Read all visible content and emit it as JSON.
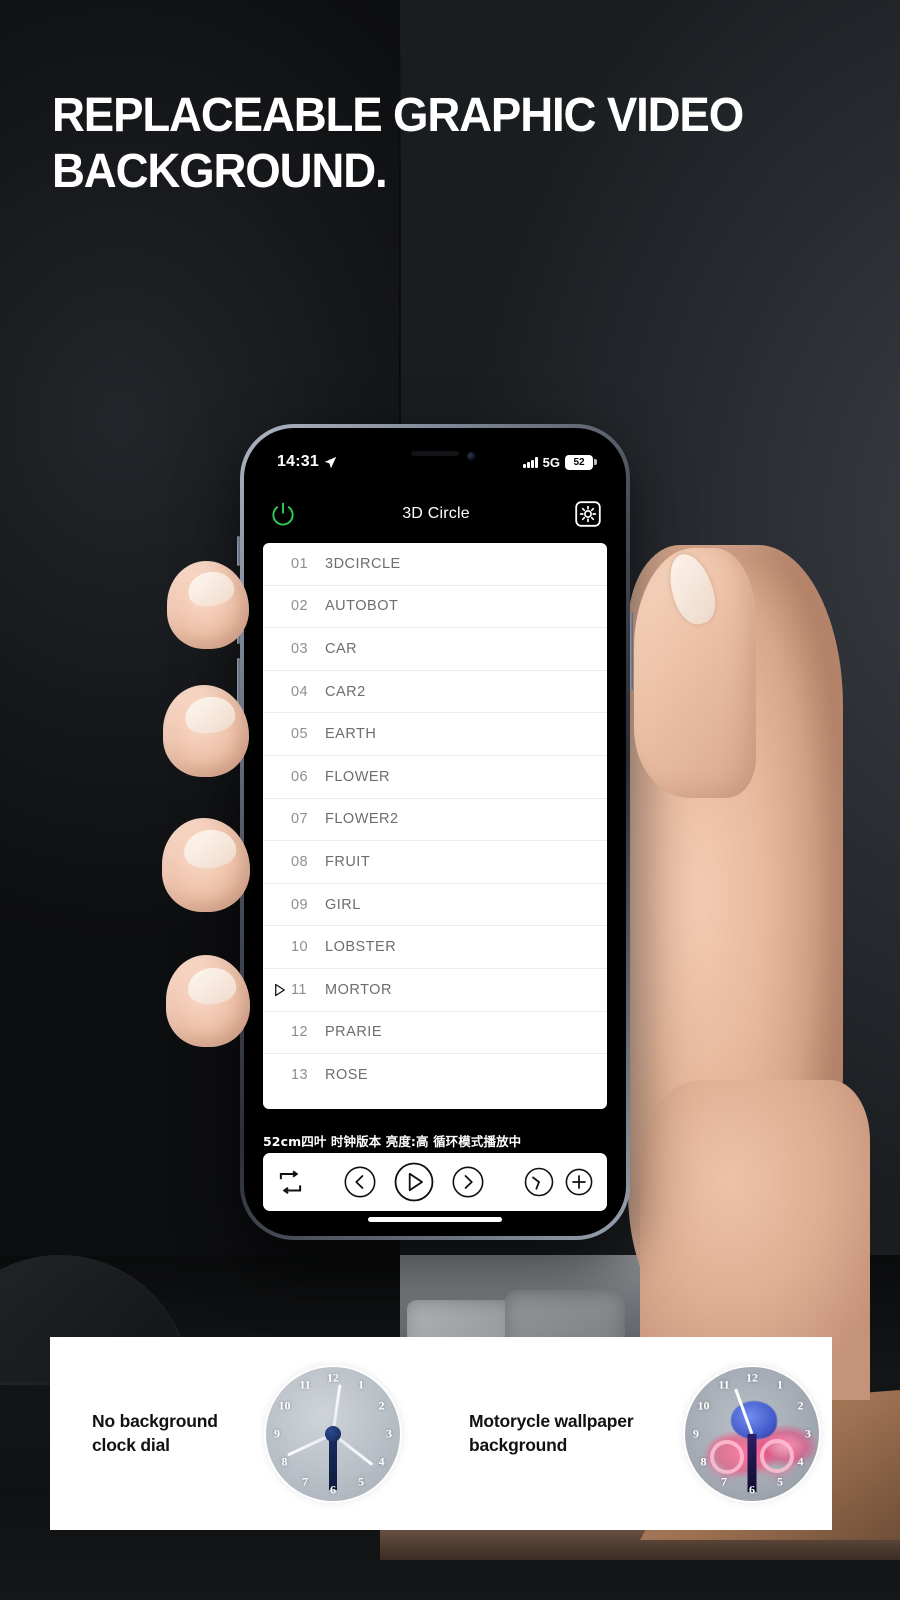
{
  "headline": {
    "line1": "REPLACEABLE GRAPHIC VIDEO",
    "line2": "BACKGROUND."
  },
  "phone": {
    "status_bar": {
      "time": "14:31",
      "location_icon": "location-arrow-icon",
      "signal_icon": "signal-bars-icon",
      "network": "5G",
      "battery_level": "52"
    },
    "app_header": {
      "power_icon": "power-icon",
      "title": "3D Circle",
      "settings_icon": "gear-icon",
      "power_color": "#2fd35a"
    },
    "list": [
      {
        "num": "01",
        "name": "3DCIRCLE",
        "playing": false
      },
      {
        "num": "02",
        "name": "AUTOBOT",
        "playing": false
      },
      {
        "num": "03",
        "name": "CAR",
        "playing": false
      },
      {
        "num": "04",
        "name": "CAR2",
        "playing": false
      },
      {
        "num": "05",
        "name": "EARTH",
        "playing": false
      },
      {
        "num": "06",
        "name": "FLOWER",
        "playing": false
      },
      {
        "num": "07",
        "name": "FLOWER2",
        "playing": false
      },
      {
        "num": "08",
        "name": "FRUIT",
        "playing": false
      },
      {
        "num": "09",
        "name": "GIRL",
        "playing": false
      },
      {
        "num": "10",
        "name": "LOBSTER",
        "playing": false
      },
      {
        "num": "11",
        "name": "MORTOR",
        "playing": true
      },
      {
        "num": "12",
        "name": "PRARIE",
        "playing": false
      },
      {
        "num": "13",
        "name": "ROSE",
        "playing": false
      }
    ],
    "status_strip": "52cm四叶 时钟版本 亮度:高 循环模式播放中",
    "controls": [
      {
        "name": "loop-mode-button",
        "icon": "repeat-icon"
      },
      {
        "name": "previous-button",
        "icon": "chevron-left-circle-icon"
      },
      {
        "name": "play-button",
        "icon": "play-circle-icon"
      },
      {
        "name": "next-button",
        "icon": "chevron-right-circle-icon"
      },
      {
        "name": "brightness-button",
        "icon": "brightness-dial-icon"
      },
      {
        "name": "add-button",
        "icon": "plus-circle-icon"
      }
    ]
  },
  "info_cards": [
    {
      "text_line1": "No background",
      "text_line2": "clock dial",
      "preview": "plain-fan-clock-dial"
    },
    {
      "text_line1": "Motorycle wallpaper",
      "text_line2": "background",
      "preview": "motorcycle-wallpaper-clock-dial"
    }
  ],
  "clock_numerals": [
    "12",
    "1",
    "2",
    "3",
    "4",
    "5",
    "6",
    "7",
    "8",
    "9",
    "10",
    "11"
  ]
}
